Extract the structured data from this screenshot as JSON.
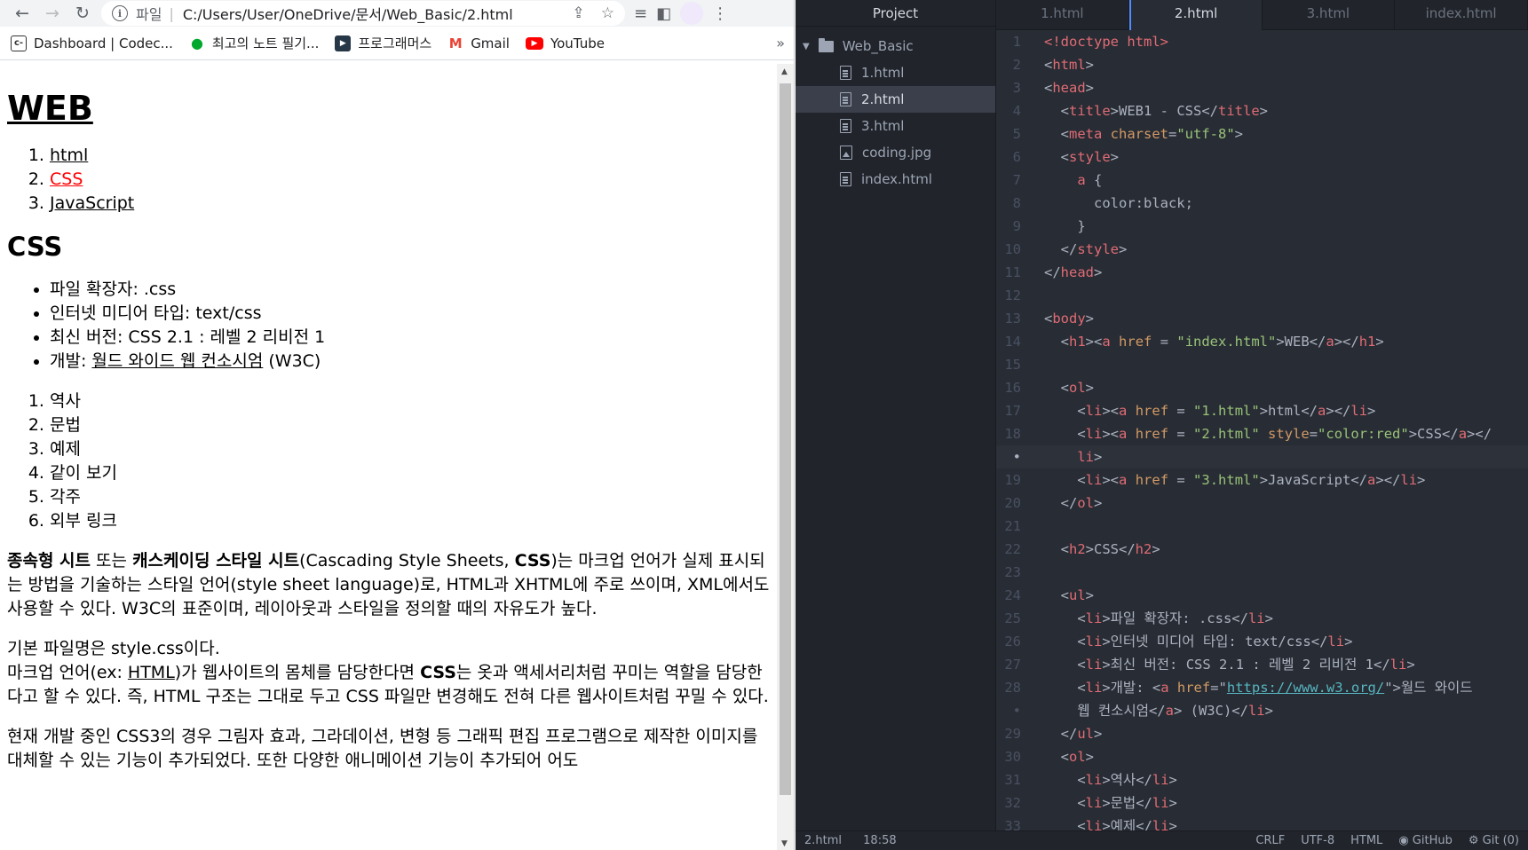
{
  "browser": {
    "nav": {
      "back_icon": "←",
      "forward_icon": "→",
      "reload_icon": "↻"
    },
    "address": {
      "protocol": "파일",
      "separator": "|",
      "url": "C:/Users/User/OneDrive/문서/Web_Basic/2.html"
    },
    "bookmarks": [
      {
        "label": "Dashboard | Codec...",
        "icon": "c-",
        "color": "#333333"
      },
      {
        "label": "최고의 노트 필기...",
        "icon": "●",
        "color": "#00a82d"
      },
      {
        "label": "프로그래머스",
        "icon": "▶",
        "color": "#263747"
      },
      {
        "label": "Gmail",
        "icon": "M",
        "color": "#ea4335"
      },
      {
        "label": "YouTube",
        "icon": "▶",
        "color": "#ff0000"
      }
    ],
    "bookmarks_more": "»"
  },
  "page": {
    "h1": "WEB",
    "nav_list": [
      "html",
      "CSS",
      "JavaScript"
    ],
    "h2": "CSS",
    "info_list": [
      "파일 확장자: .css",
      "인터넷 미디어 타입: text/css",
      "최신 버전: CSS 2.1 : 레벨 2 리비전 1"
    ],
    "info_dev_prefix": "개발: ",
    "info_dev_link": "월드 와이드 웹 컨소시엄",
    "info_dev_suffix": " (W3C)",
    "toc": [
      "역사",
      "문법",
      "예제",
      "같이 보기",
      "각주",
      "외부 링크"
    ],
    "p1_b1": "종속형 시트",
    "p1_t1": " 또는 ",
    "p1_b2": "캐스케이딩 스타일 시트",
    "p1_t2": "(Cascading Style Sheets, ",
    "p1_b3": "CSS",
    "p1_t3": ")는 마크업 언어가 실제 표시되는 방법을 기술하는 스타일 언어(style sheet language)로, HTML과 XHTML에 주로 쓰이며, XML에서도 사용할 수 있다. W3C의 표준이며, 레이아웃과 스타일을 정의할 때의 자유도가 높다.",
    "p2_line1": "기본 파일명은 style.css이다.",
    "p2_t1": "마크업 언어(ex: ",
    "p2_link": "HTML",
    "p2_t2": ")가 웹사이트의 몸체를 담당한다면 ",
    "p2_b": "CSS",
    "p2_t3": "는 옷과 액세서리처럼 꾸미는 역할을 담당한다고 할 수 있다. 즉, HTML 구조는 그대로 두고 CSS 파일만 변경해도 전혀 다른 웹사이트처럼 꾸밀 수 있다.",
    "p3": "현재 개발 중인 CSS3의 경우 그림자 효과, 그라데이션, 변형 등 그래픽 편집 프로그램으로 제작한 이미지를 대체할 수 있는 기능이 추가되었다. 또한 다양한 애니메이션 기능이 추가되어 어도"
  },
  "editor": {
    "tree_title": "Project",
    "folder": "Web_Basic",
    "files": [
      "1.html",
      "2.html",
      "3.html",
      "coding.jpg",
      "index.html"
    ],
    "selected_file": "2.html",
    "tabs": [
      "1.html",
      "2.html",
      "3.html",
      "index.html"
    ],
    "active_tab": "2.html",
    "status": {
      "file": "2.html",
      "cursor": "18:58",
      "eol": "CRLF",
      "encoding": "UTF-8",
      "grammar": "HTML",
      "github": "GitHub",
      "git": "Git (0)"
    },
    "code": [
      {
        "n": "1",
        "parts": [
          [
            "t",
            "<!doctype html>"
          ]
        ]
      },
      {
        "n": "2",
        "parts": [
          [
            "p",
            "<"
          ],
          [
            "t",
            "html"
          ],
          [
            "p",
            ">"
          ]
        ]
      },
      {
        "n": "3",
        "parts": [
          [
            "p",
            "<"
          ],
          [
            "t",
            "head"
          ],
          [
            "p",
            ">"
          ]
        ]
      },
      {
        "n": "4",
        "parts": [
          [
            "p",
            "  <"
          ],
          [
            "t",
            "title"
          ],
          [
            "p",
            ">WEB1 - CSS</"
          ],
          [
            "t",
            "title"
          ],
          [
            "p",
            ">"
          ]
        ]
      },
      {
        "n": "5",
        "parts": [
          [
            "p",
            "  <"
          ],
          [
            "t",
            "meta"
          ],
          [
            "p",
            " "
          ],
          [
            "at",
            "charset"
          ],
          [
            "p",
            "="
          ],
          [
            "s",
            "\"utf-8\""
          ],
          [
            "p",
            ">"
          ]
        ]
      },
      {
        "n": "6",
        "parts": [
          [
            "p",
            "  <"
          ],
          [
            "t",
            "style"
          ],
          [
            "p",
            ">"
          ]
        ]
      },
      {
        "n": "7",
        "parts": [
          [
            "p",
            "    "
          ],
          [
            "t",
            "a"
          ],
          [
            "p",
            " {"
          ]
        ]
      },
      {
        "n": "8",
        "parts": [
          [
            "p",
            "      color:black;"
          ]
        ]
      },
      {
        "n": "9",
        "parts": [
          [
            "p",
            "    }"
          ]
        ]
      },
      {
        "n": "10",
        "parts": [
          [
            "p",
            "  </"
          ],
          [
            "t",
            "style"
          ],
          [
            "p",
            ">"
          ]
        ]
      },
      {
        "n": "11",
        "parts": [
          [
            "p",
            "</"
          ],
          [
            "t",
            "head"
          ],
          [
            "p",
            ">"
          ]
        ]
      },
      {
        "n": "12",
        "parts": []
      },
      {
        "n": "13",
        "parts": [
          [
            "p",
            "<"
          ],
          [
            "t",
            "body"
          ],
          [
            "p",
            ">"
          ]
        ]
      },
      {
        "n": "14",
        "parts": [
          [
            "p",
            "  <"
          ],
          [
            "t",
            "h1"
          ],
          [
            "p",
            "><"
          ],
          [
            "t",
            "a"
          ],
          [
            "p",
            " "
          ],
          [
            "at",
            "href"
          ],
          [
            "p",
            " = "
          ],
          [
            "s",
            "\"index.html\""
          ],
          [
            "p",
            ">WEB</"
          ],
          [
            "t",
            "a"
          ],
          [
            "p",
            "></"
          ],
          [
            "t",
            "h1"
          ],
          [
            "p",
            ">"
          ]
        ]
      },
      {
        "n": "15",
        "parts": []
      },
      {
        "n": "16",
        "parts": [
          [
            "p",
            "  <"
          ],
          [
            "t",
            "ol"
          ],
          [
            "p",
            ">"
          ]
        ]
      },
      {
        "n": "17",
        "parts": [
          [
            "p",
            "    <"
          ],
          [
            "t",
            "li"
          ],
          [
            "p",
            "><"
          ],
          [
            "t",
            "a"
          ],
          [
            "p",
            " "
          ],
          [
            "at",
            "href"
          ],
          [
            "p",
            " = "
          ],
          [
            "s",
            "\"1.html\""
          ],
          [
            "p",
            ">html</"
          ],
          [
            "t",
            "a"
          ],
          [
            "p",
            "></"
          ],
          [
            "t",
            "li"
          ],
          [
            "p",
            ">"
          ]
        ]
      },
      {
        "n": "18",
        "parts": [
          [
            "p",
            "    <"
          ],
          [
            "t",
            "li"
          ],
          [
            "p",
            "><"
          ],
          [
            "t",
            "a"
          ],
          [
            "p",
            " "
          ],
          [
            "at",
            "href"
          ],
          [
            "p",
            " = "
          ],
          [
            "s",
            "\"2.html\""
          ],
          [
            "p",
            " "
          ],
          [
            "at",
            "style"
          ],
          [
            "p",
            "="
          ],
          [
            "s",
            "\"color:red\""
          ],
          [
            "p",
            ">CSS</"
          ],
          [
            "t",
            "a"
          ],
          [
            "p",
            "></"
          ]
        ]
      },
      {
        "n": "•",
        "parts": [
          [
            "p",
            "    "
          ],
          [
            "t",
            "li"
          ],
          [
            "p",
            ">"
          ]
        ],
        "cur": true
      },
      {
        "n": "19",
        "parts": [
          [
            "p",
            "    <"
          ],
          [
            "t",
            "li"
          ],
          [
            "p",
            "><"
          ],
          [
            "t",
            "a"
          ],
          [
            "p",
            " "
          ],
          [
            "at",
            "href"
          ],
          [
            "p",
            " = "
          ],
          [
            "s",
            "\"3.html\""
          ],
          [
            "p",
            ">JavaScript</"
          ],
          [
            "t",
            "a"
          ],
          [
            "p",
            "></"
          ],
          [
            "t",
            "li"
          ],
          [
            "p",
            ">"
          ]
        ]
      },
      {
        "n": "20",
        "parts": [
          [
            "p",
            "  </"
          ],
          [
            "t",
            "ol"
          ],
          [
            "p",
            ">"
          ]
        ]
      },
      {
        "n": "21",
        "parts": []
      },
      {
        "n": "22",
        "parts": [
          [
            "p",
            "  <"
          ],
          [
            "t",
            "h2"
          ],
          [
            "p",
            ">CSS</"
          ],
          [
            "t",
            "h2"
          ],
          [
            "p",
            ">"
          ]
        ]
      },
      {
        "n": "23",
        "parts": []
      },
      {
        "n": "24",
        "parts": [
          [
            "p",
            "  <"
          ],
          [
            "t",
            "ul"
          ],
          [
            "p",
            ">"
          ]
        ]
      },
      {
        "n": "25",
        "parts": [
          [
            "p",
            "    <"
          ],
          [
            "t",
            "li"
          ],
          [
            "p",
            ">파일 확장자: .css</"
          ],
          [
            "t",
            "li"
          ],
          [
            "p",
            ">"
          ]
        ]
      },
      {
        "n": "26",
        "parts": [
          [
            "p",
            "    <"
          ],
          [
            "t",
            "li"
          ],
          [
            "p",
            ">인터넷 미디어 타입: text/css</"
          ],
          [
            "t",
            "li"
          ],
          [
            "p",
            ">"
          ]
        ]
      },
      {
        "n": "27",
        "parts": [
          [
            "p",
            "    <"
          ],
          [
            "t",
            "li"
          ],
          [
            "p",
            ">최신 버전: CSS 2.1 : 레벨 2 리비전 1</"
          ],
          [
            "t",
            "li"
          ],
          [
            "p",
            ">"
          ]
        ]
      },
      {
        "n": "28",
        "parts": [
          [
            "p",
            "    <"
          ],
          [
            "t",
            "li"
          ],
          [
            "p",
            ">개발: <"
          ],
          [
            "t",
            "a"
          ],
          [
            "p",
            " "
          ],
          [
            "at",
            "href"
          ],
          [
            "p",
            "=\""
          ],
          [
            "u",
            "https://www.w3.org/"
          ],
          [
            "p",
            "\">월드 와이드"
          ]
        ]
      },
      {
        "n": "•",
        "parts": [
          [
            "p",
            "    웹 컨소시엄</"
          ],
          [
            "t",
            "a"
          ],
          [
            "p",
            "> (W3C)</"
          ],
          [
            "t",
            "li"
          ],
          [
            "p",
            ">"
          ]
        ]
      },
      {
        "n": "29",
        "parts": [
          [
            "p",
            "  </"
          ],
          [
            "t",
            "ul"
          ],
          [
            "p",
            ">"
          ]
        ]
      },
      {
        "n": "30",
        "parts": [
          [
            "p",
            "  <"
          ],
          [
            "t",
            "ol"
          ],
          [
            "p",
            ">"
          ]
        ]
      },
      {
        "n": "31",
        "parts": [
          [
            "p",
            "    <"
          ],
          [
            "t",
            "li"
          ],
          [
            "p",
            ">역사</"
          ],
          [
            "t",
            "li"
          ],
          [
            "p",
            ">"
          ]
        ]
      },
      {
        "n": "32",
        "parts": [
          [
            "p",
            "    <"
          ],
          [
            "t",
            "li"
          ],
          [
            "p",
            ">문법</"
          ],
          [
            "t",
            "li"
          ],
          [
            "p",
            ">"
          ]
        ]
      },
      {
        "n": "33",
        "parts": [
          [
            "p",
            "    <"
          ],
          [
            "t",
            "li"
          ],
          [
            "p",
            ">예제</"
          ],
          [
            "t",
            "li"
          ],
          [
            "p",
            ">"
          ]
        ]
      }
    ]
  }
}
